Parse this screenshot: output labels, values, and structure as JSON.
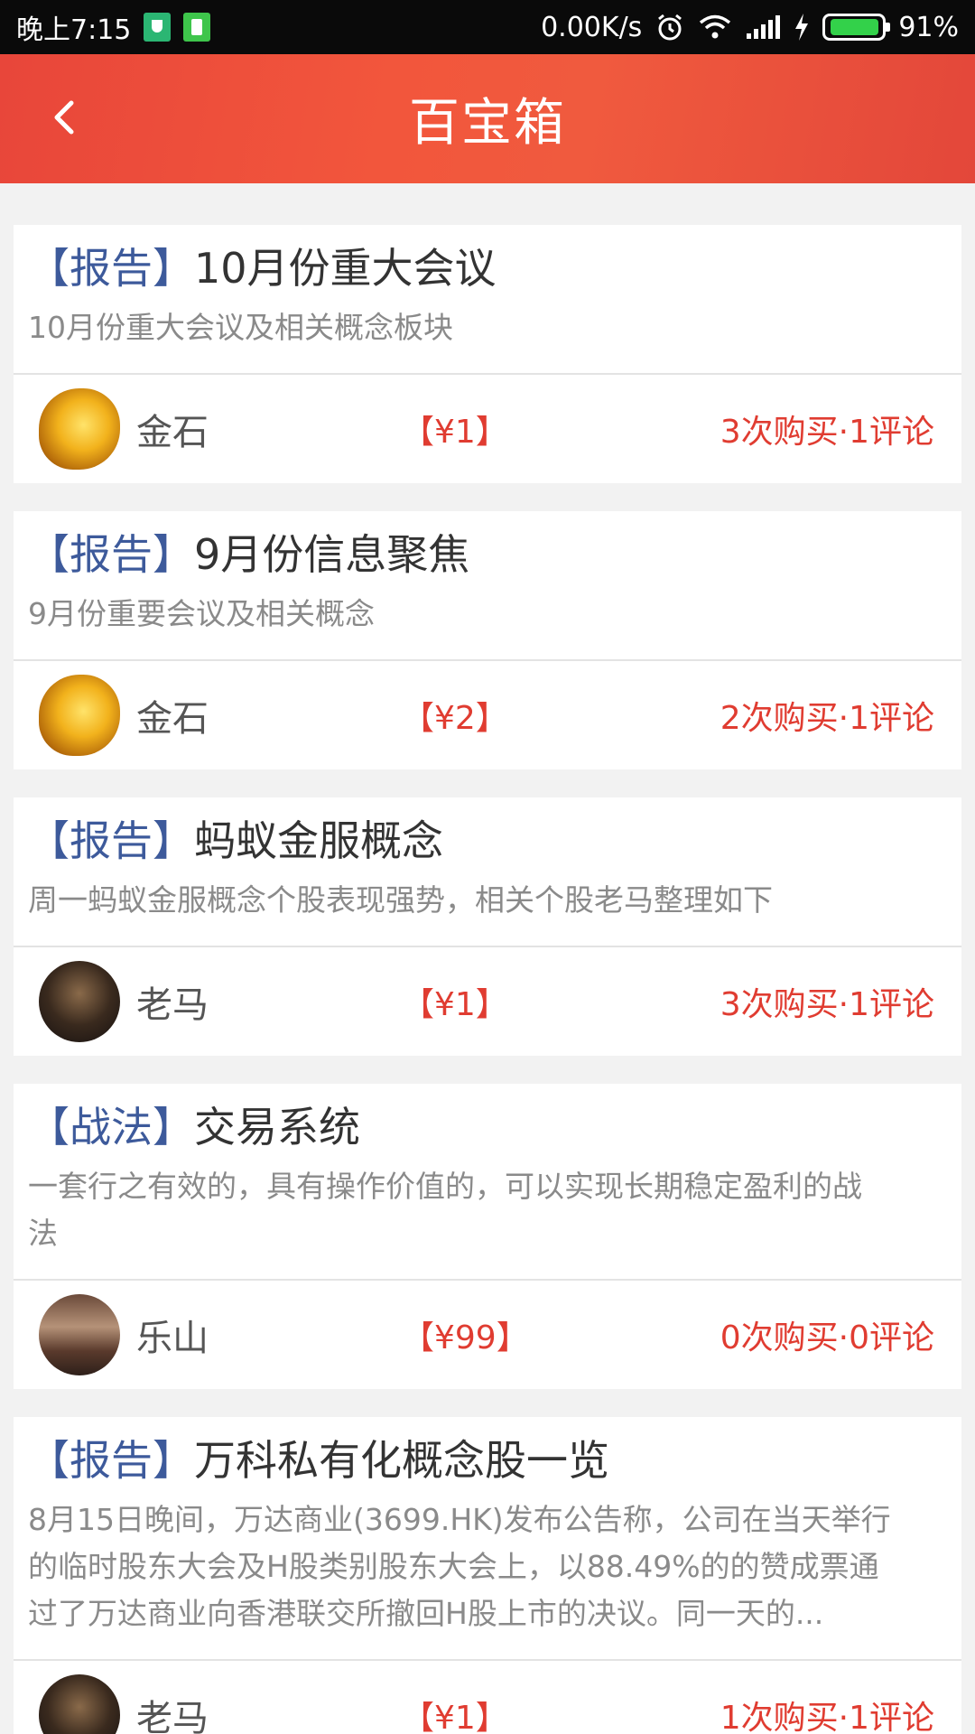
{
  "status_bar": {
    "time": "晚上7:15",
    "network_speed": "0.00K/s",
    "battery_percent": "91%",
    "icons": [
      "shield-icon",
      "battery-app-icon",
      "alarm-icon",
      "wifi-icon",
      "signal-icon",
      "charging-icon",
      "battery-icon"
    ]
  },
  "header": {
    "title": "百宝箱",
    "back_icon": "chevron-left-icon"
  },
  "colors": {
    "header_bg": "#f0533c",
    "tag_blue": "#3d5a9b",
    "accent_red": "#e03c31",
    "background": "#f2f2f2"
  },
  "cards": [
    {
      "tag": "【报告】",
      "title": "10月份重大会议",
      "desc_lines": [
        "10月份重大会议及相关概念板块"
      ],
      "author": "金石",
      "avatar": "amber-stone-avatar",
      "price": "【¥1】",
      "stats": "3次购买·1评论"
    },
    {
      "tag": "【报告】",
      "title": "9月份信息聚焦",
      "desc_lines": [
        "9月份重要会议及相关概念"
      ],
      "author": "金石",
      "avatar": "amber-stone-avatar",
      "price": "【¥2】",
      "stats": "2次购买·1评论"
    },
    {
      "tag": "【报告】",
      "title": "蚂蚁金服概念",
      "desc_lines": [
        "周一蚂蚁金服概念个股表现强势，相关个股老马整理如下"
      ],
      "author": "老马",
      "avatar": "person-avatar",
      "price": "【¥1】",
      "stats": "3次购买·1评论"
    },
    {
      "tag": "【战法】",
      "title": "交易系统",
      "desc_lines": [
        "一套行之有效的，具有操作价值的，可以实现长期稳定盈利的战",
        "法"
      ],
      "author": "乐山",
      "avatar": "office-avatar",
      "price": "【¥99】",
      "stats": "0次购买·0评论"
    },
    {
      "tag": "【报告】",
      "title": "万科私有化概念股一览",
      "desc_lines": [
        "8月15日晚间，万达商业(3699.HK)发布公告称，公司在当天举行",
        "的临时股东大会及H股类别股东大会上，以88.49%的的赞成票通",
        "过了万达商业向香港联交所撤回H股上市的决议。同一天的..."
      ],
      "author": "老马",
      "avatar": "person-avatar",
      "price": "【¥1】",
      "stats": "1次购买·1评论"
    }
  ]
}
